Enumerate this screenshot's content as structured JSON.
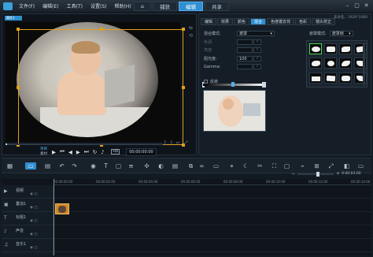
{
  "menu": [
    "文件(F)",
    "编辑(E)",
    "工具(T)",
    "设置(S)",
    "帮助(H)"
  ],
  "workspace_tabs": [
    "捕获",
    "编辑",
    "共享"
  ],
  "active_workspace": "编辑",
  "player": {
    "tab_label": "属性1",
    "modes": [
      "项目",
      "素材"
    ],
    "active_mode": "项目",
    "quality_badge": "HD",
    "timecode": "00:00:00:00",
    "progress": 0.0
  },
  "options": {
    "project_info": "未命名，1920*1080",
    "subtabs": [
      "编辑",
      "效果",
      "颜色",
      "混合",
      "色度键去背",
      "色彩",
      "镜头校正"
    ],
    "active_subtab": "混合",
    "blend_mode_label": "混合模式:",
    "blend_mode_value": "遮罩",
    "hue_label": "色调:",
    "saturation_label": "亮度:",
    "gamma_label": "阻光度:",
    "gamma_value": "100",
    "gamma_strength_label": "Gamma:",
    "invert_label": "反转",
    "mask_type_label": "遮罩模式:",
    "mask_type_value": "遮罩帧",
    "mask_count": 12,
    "selected_mask": 0
  },
  "timeline": {
    "ruler": [
      "00:00:00:00",
      "00:00:02:00",
      "00:00:04:00",
      "00:00:06:00",
      "00:00:08:00",
      "00:00:10:00",
      "00:00:12:00",
      "00:00:14:00"
    ],
    "tracks": [
      {
        "name": "视频",
        "icon": "video-track-icon",
        "glyph": "▶"
      },
      {
        "name": "叠加1",
        "icon": "overlay-track-icon",
        "glyph": "▣"
      },
      {
        "name": "标题1",
        "icon": "title-track-icon",
        "glyph": "T"
      },
      {
        "name": "声音",
        "icon": "voice-track-icon",
        "glyph": "♪"
      },
      {
        "name": "音乐1",
        "icon": "music-track-icon",
        "glyph": "♫"
      }
    ],
    "zoom_time": "0:00:03:00"
  },
  "colors": {
    "accent": "#2f8fd0",
    "selection": "#e3a019",
    "clip": "#d08a28"
  }
}
